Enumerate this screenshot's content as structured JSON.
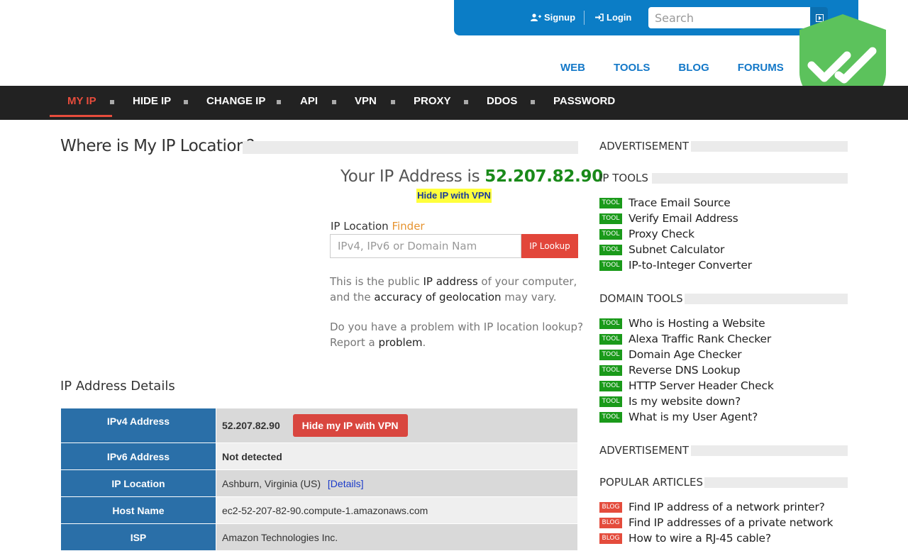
{
  "header": {
    "signup_label": "Signup",
    "login_label": "Login",
    "search_placeholder": "Search"
  },
  "subnav": [
    "WEB",
    "TOOLS",
    "BLOG",
    "FORUMS"
  ],
  "mainnav": [
    "MY IP",
    "HIDE IP",
    "CHANGE IP",
    "API",
    "VPN",
    "PROXY",
    "DDOS",
    "PASSWORD"
  ],
  "main": {
    "title": "Where is My IP Location?",
    "your_ip_prefix": "Your IP Address is",
    "ip": "52.207.82.90",
    "hide_vpn_label": "Hide IP with VPN",
    "finder_label": "IP Location",
    "finder_accent": "Finder",
    "input_placeholder": "IPv4, IPv6 or Domain Nam",
    "lookup_label": "IP Lookup",
    "para1_a": "This is the public",
    "para1_link1": "IP address",
    "para1_b": "of your computer, and the",
    "para1_link2": "accuracy of geolocation",
    "para1_c": "may vary.",
    "para2_a": "Do you have a problem with IP location lookup? Report a",
    "para2_link": "problem",
    "para2_b": ".",
    "details_title": "IP Address Details"
  },
  "details": {
    "ipv4_label": "IPv4 Address",
    "ipv4_value": "52.207.82.90",
    "hide_button": "Hide my IP with VPN",
    "ipv6_label": "IPv6 Address",
    "ipv6_value": "Not detected",
    "location_label": "IP Location",
    "location_value": "Ashburn, Virginia (US)",
    "location_link": "[Details]",
    "host_label": "Host Name",
    "host_value": "ec2-52-207-82-90.compute-1.amazonaws.com",
    "isp_label": "ISP",
    "isp_value": "Amazon Technologies Inc."
  },
  "sidebar": {
    "advertisement": "ADVERTISEMENT",
    "ip_tools_title": "IP TOOLS",
    "ip_tools": [
      "Trace Email Source",
      "Verify Email Address",
      "Proxy Check",
      "Subnet Calculator",
      "IP-to-Integer Converter"
    ],
    "domain_tools_title": "DOMAIN TOOLS",
    "domain_tools": [
      "Who is Hosting a Website",
      "Alexa Traffic Rank Checker",
      "Domain Age Checker",
      "Reverse DNS Lookup",
      "HTTP Server Header Check",
      "Is my website down?",
      "What is my User Agent?"
    ],
    "popular_title": "POPULAR ARTICLES",
    "articles": [
      "Find IP address of a network printer?",
      "Find IP addresses of a private network",
      "How to wire a RJ-45 cable?"
    ],
    "tool_badge": "TOOL",
    "blog_badge": "BLOG"
  },
  "colors": {
    "brand_blue": "#0b7dc6",
    "nav_dark": "#222222",
    "accent_red": "#e74c3c",
    "ip_green": "#1a8a1a",
    "shield_green": "#5cc25c"
  }
}
